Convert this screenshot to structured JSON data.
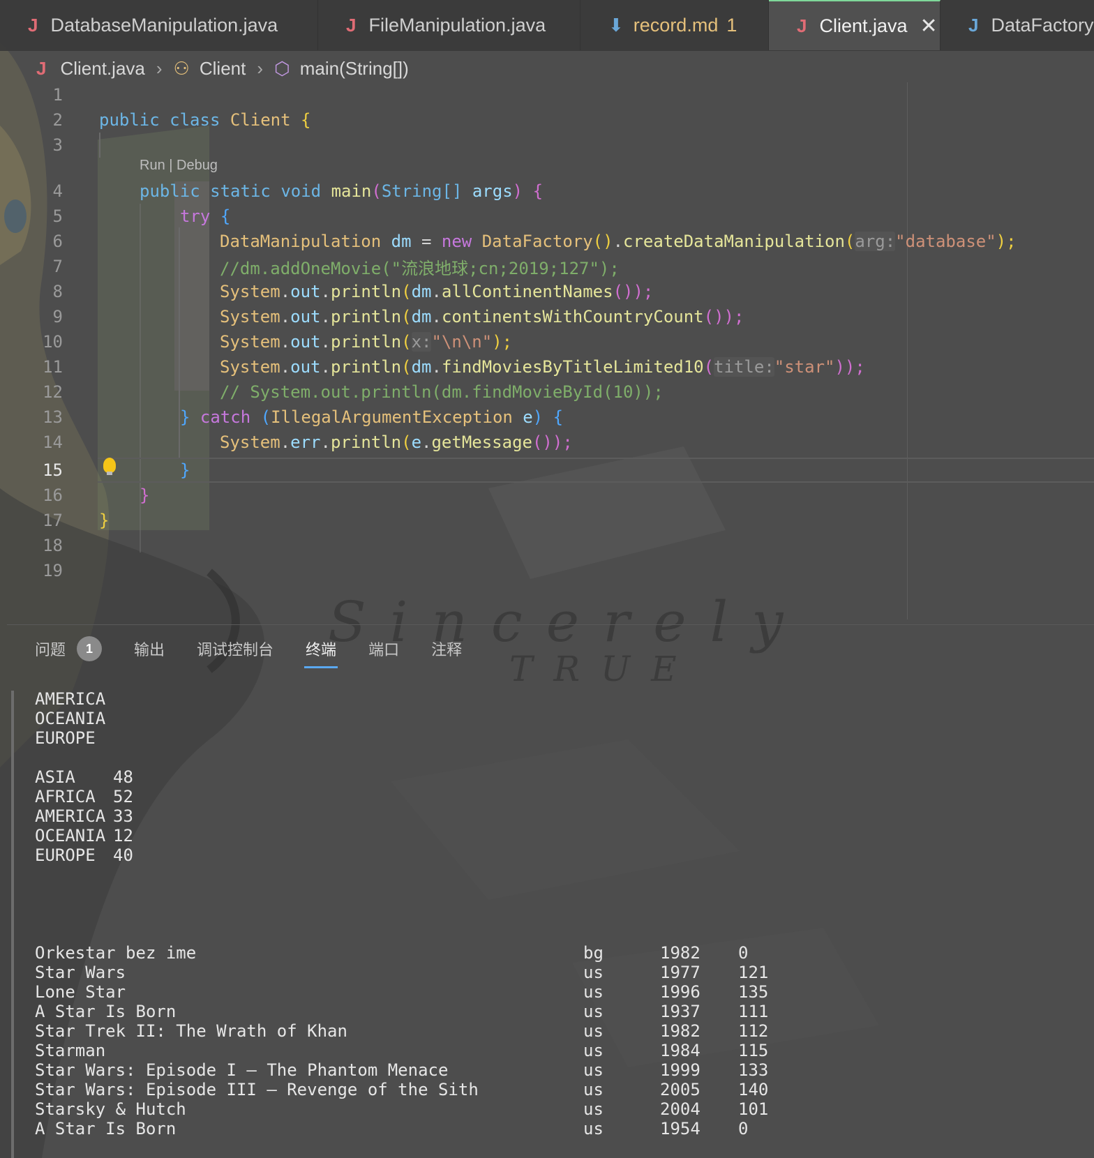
{
  "tabs": [
    {
      "label": "DatabaseManipulation.java",
      "icon": "java-file-icon"
    },
    {
      "label": "FileManipulation.java",
      "icon": "java-file-icon"
    },
    {
      "label": "record.md",
      "icon": "markdown-file-icon",
      "problems": "1"
    },
    {
      "label": "Client.java",
      "icon": "java-file-icon",
      "active": true
    },
    {
      "label": "DataFactory.java",
      "icon": "java-file-icon"
    }
  ],
  "breadcrumb": {
    "file": "Client.java",
    "class": "Client",
    "method": "main(String[])"
  },
  "editor": {
    "code_lens": "Run | Debug",
    "current_line": "15",
    "line_numbers": [
      "1",
      "2",
      "3",
      "4",
      "5",
      "6",
      "7",
      "8",
      "9",
      "10",
      "11",
      "12",
      "13",
      "14",
      "15",
      "16",
      "17",
      "18",
      "19"
    ],
    "lines": {
      "l2_kw1": "public",
      "l2_kw2": "class",
      "l2_cls": "Client",
      "l2_brace": "{",
      "l4_kw1": "public",
      "l4_kw2": "static",
      "l4_kw3": "void",
      "l4_fn": "main",
      "l4_p1": "(",
      "l4_type": "String[]",
      "l4_arg": "args",
      "l4_p2": ")",
      "l4_brace": "{",
      "l5_kw": "try",
      "l5_brace": "{",
      "l6_type": "DataManipulation",
      "l6_var": "dm",
      "l6_eq": " = ",
      "l6_new": "new",
      "l6_cls": "DataFactory",
      "l6_paren": "()",
      "l6_dot": ".",
      "l6_fn": "createDataManipulation",
      "l6_p1": "(",
      "l6_hint": "arg:",
      "l6_str": "\"database\"",
      "l6_end": ");",
      "l7_cmt": "//dm.addOneMovie(\"流浪地球;cn;2019;127\");",
      "l8_sys": "System",
      "l8_out": "out",
      "l8_fn": "println",
      "l8_dm": "dm",
      "l8_fn2": "allContinentNames",
      "l8_end": "());",
      "l9_sys": "System",
      "l9_out": "out",
      "l9_fn": "println",
      "l9_dm": "dm",
      "l9_fn2": "continentsWithCountryCount",
      "l9_end": "());",
      "l10_sys": "System",
      "l10_out": "out",
      "l10_fn": "println",
      "l10_hint": "x:",
      "l10_str": "\"\\n\\n\"",
      "l10_end": ");",
      "l11_sys": "System",
      "l11_out": "out",
      "l11_fn": "println",
      "l11_dm": "dm",
      "l11_fn2": "findMoviesByTitleLimited10",
      "l11_hint": "title:",
      "l11_str": "\"star\"",
      "l11_end": "));",
      "l12_cmt": "// System.out.println(dm.findMovieById(10));",
      "l13_brace": "}",
      "l13_kw": "catch",
      "l13_p1": "(",
      "l13_type": "IllegalArgumentException",
      "l13_var": "e",
      "l13_p2": ")",
      "l13_brace2": "{",
      "l14_sys": "System",
      "l14_err": "err",
      "l14_fn": "println",
      "l14_var": "e",
      "l14_fn2": "getMessage",
      "l14_end": "());",
      "l15_brace": "}",
      "l16_brace": "}",
      "l17_brace": "}"
    }
  },
  "panel": {
    "tabs": [
      {
        "label": "问题",
        "badge": "1"
      },
      {
        "label": "输出"
      },
      {
        "label": "调试控制台"
      },
      {
        "label": "终端",
        "active": true
      },
      {
        "label": "端口"
      },
      {
        "label": "注释"
      }
    ]
  },
  "watermark": {
    "line1": "Sincerely",
    "line2": "TRUE"
  },
  "terminal": {
    "continents": [
      "AMERICA",
      "OCEANIA",
      "EUROPE"
    ],
    "continent_counts": [
      {
        "name": "ASIA",
        "count": "48"
      },
      {
        "name": "AFRICA",
        "count": "52"
      },
      {
        "name": "AMERICA",
        "count": "33"
      },
      {
        "name": "OCEANIA",
        "count": "12"
      },
      {
        "name": "EUROPE",
        "count": "40"
      }
    ],
    "movies": [
      {
        "title": "Orkestar bez ime",
        "country": "bg",
        "year": "1982",
        "runtime": "0"
      },
      {
        "title": "Star Wars",
        "country": "us",
        "year": "1977",
        "runtime": "121"
      },
      {
        "title": "Lone Star",
        "country": "us",
        "year": "1996",
        "runtime": "135"
      },
      {
        "title": "A Star Is Born",
        "country": "us",
        "year": "1937",
        "runtime": "111"
      },
      {
        "title": "Star Trek II: The Wrath of Khan",
        "country": "us",
        "year": "1982",
        "runtime": "112"
      },
      {
        "title": "Starman",
        "country": "us",
        "year": "1984",
        "runtime": "115"
      },
      {
        "title": "Star Wars: Episode I – The Phantom Menace",
        "country": "us",
        "year": "1999",
        "runtime": "133"
      },
      {
        "title": "Star Wars: Episode III – Revenge of the Sith",
        "country": "us",
        "year": "2005",
        "runtime": "140"
      },
      {
        "title": "Starsky & Hutch",
        "country": "us",
        "year": "2004",
        "runtime": "101"
      },
      {
        "title": "A Star Is Born",
        "country": "us",
        "year": "1954",
        "runtime": "0"
      }
    ]
  }
}
